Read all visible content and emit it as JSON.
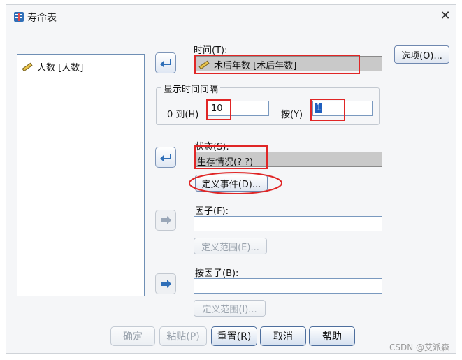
{
  "window": {
    "title": "寿命表",
    "close_symbol": "✕"
  },
  "source_list": {
    "items": [
      {
        "label": "人数 [人数]",
        "icon": "ruler-icon"
      }
    ]
  },
  "time": {
    "label": "时间(T):",
    "value": "术后年数 [术后年数]"
  },
  "interval_group": {
    "title": "显示时间间隔",
    "from_label": "0 到(H)",
    "to_value": "10",
    "step_label": "按(Y)",
    "step_value": "1"
  },
  "status": {
    "label": "状态(S):",
    "value": "生存情况(? ?)",
    "define_event_button": "定义事件(D)..."
  },
  "factor": {
    "label": "因子(F):",
    "value": "",
    "define_range_button": "定义范围(E)..."
  },
  "by_factor": {
    "label": "按因子(B):",
    "value": "",
    "define_range_button": "定义范围(I)..."
  },
  "options_button": "选项(O)...",
  "footer": {
    "ok": "确定",
    "paste": "粘贴(P)",
    "reset": "重置(R)",
    "cancel": "取消",
    "help": "帮助"
  },
  "watermark": "CSDN @艾派森",
  "colors": {
    "annotation_red": "#e02626",
    "arrow_blue": "#2f6fb8"
  }
}
